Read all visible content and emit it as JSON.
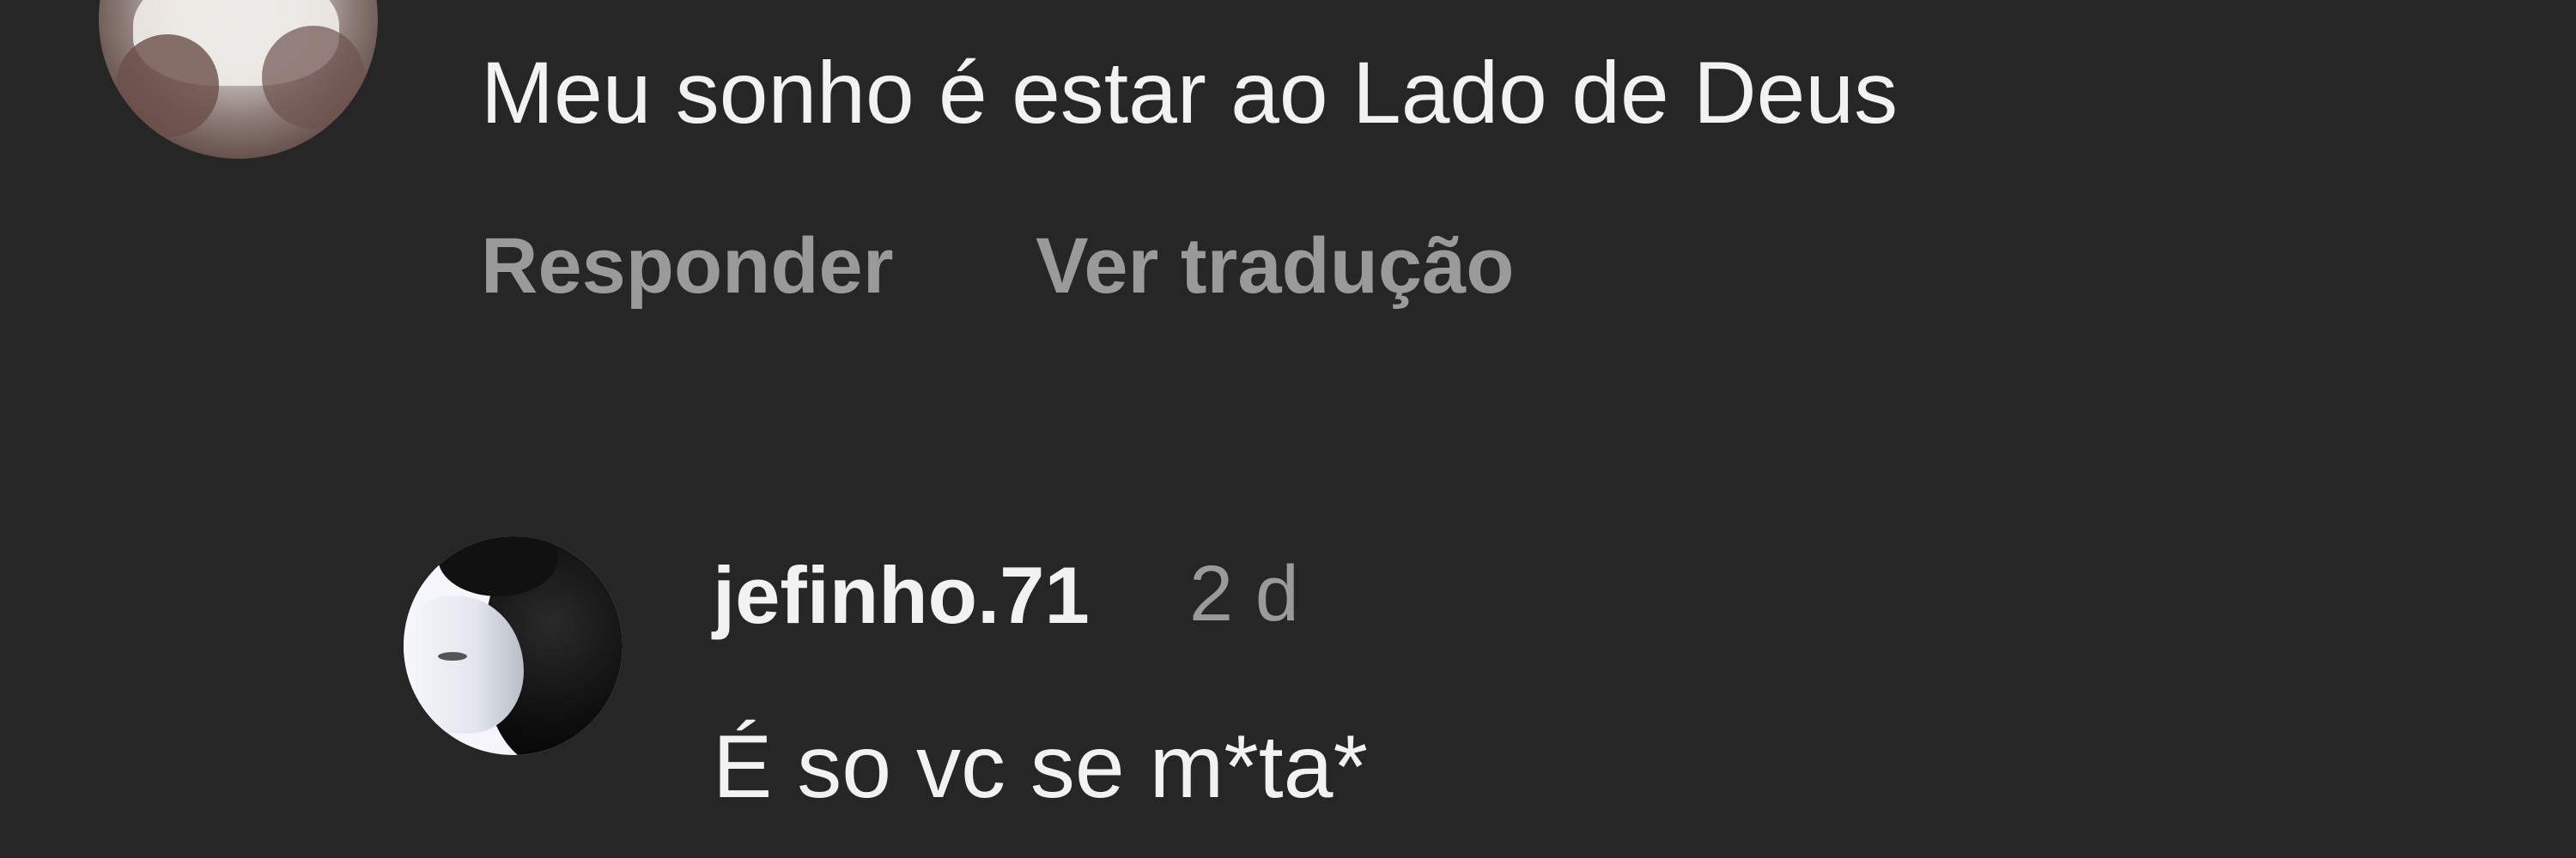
{
  "comment": {
    "text": "Meu sonho é estar ao Lado de Deus",
    "actions": {
      "reply_label": "Responder",
      "translate_label": "Ver tradução"
    }
  },
  "reply": {
    "username": "jefinho.71",
    "time": "2 d",
    "text": "É so vc se m*ta*"
  }
}
